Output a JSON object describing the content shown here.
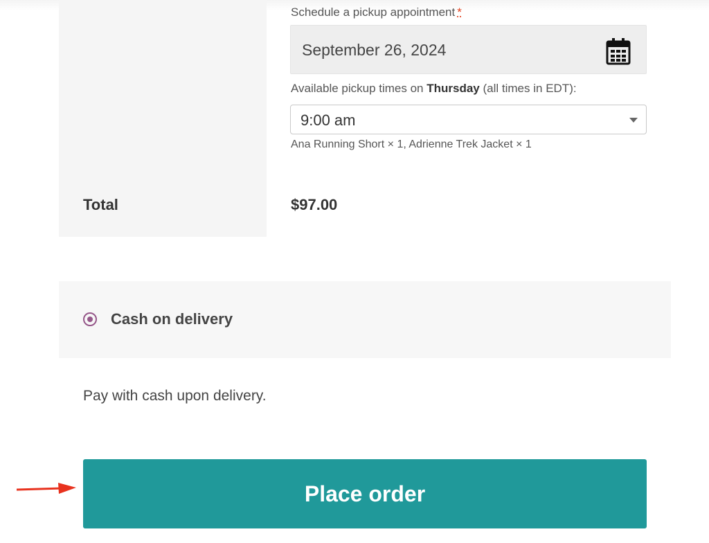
{
  "order_review": {
    "schedule_label": "Schedule a pickup appointment",
    "required_mark": "*",
    "date_value": "September 26, 2024",
    "times_caption_prefix": "Available pickup times on ",
    "times_day": "Thursday",
    "times_caption_suffix": " (all times in EDT):",
    "time_selected": "9:00 am",
    "items_line": "Ana Running Short × 1, Adrienne Trek Jacket × 1",
    "total_label": "Total",
    "total_value": "$97.00"
  },
  "payment": {
    "method_label": "Cash on delivery",
    "description": "Pay with cash upon delivery.",
    "accent_color": "#96588a"
  },
  "actions": {
    "place_order_label": "Place order",
    "button_color": "#20999a",
    "annotation_arrow_color": "#e8321e"
  },
  "icons": {
    "calendar": "calendar-icon",
    "dropdown": "chevron-down-icon",
    "radio": "radio-selected-icon",
    "pointer": "arrow-right-icon"
  }
}
